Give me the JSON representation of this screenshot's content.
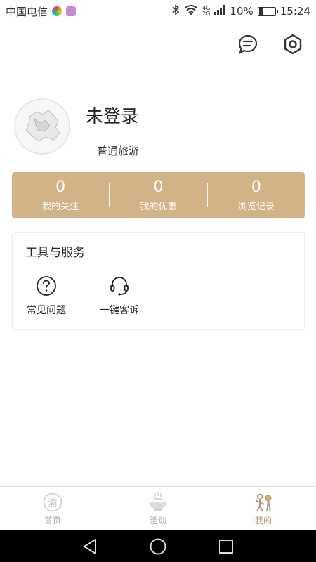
{
  "status_bar": {
    "carrier": "中国电信",
    "network_top": "4G",
    "network_bottom": "2G",
    "battery": "10%",
    "time": "15:24"
  },
  "top_actions": {
    "message_icon": "message-icon",
    "settings_icon": "settings-icon"
  },
  "profile": {
    "login_status": "未登录",
    "user_level": "普通旅游"
  },
  "stats": [
    {
      "value": "0",
      "label": "我的关注"
    },
    {
      "value": "0",
      "label": "我的优惠"
    },
    {
      "value": "0",
      "label": "浏览记录"
    }
  ],
  "tools": {
    "title": "工具与服务",
    "items": [
      {
        "label": "常见问题",
        "icon": "question-icon"
      },
      {
        "label": "一键客诉",
        "icon": "headset-icon"
      }
    ]
  },
  "bottom_nav": [
    {
      "label": "首页",
      "icon": "home-yu-icon",
      "active": false
    },
    {
      "label": "活动",
      "icon": "activity-hotpot-icon",
      "active": false
    },
    {
      "label": "我的",
      "icon": "mine-icon",
      "active": true
    }
  ],
  "colors": {
    "accent": "#d2b287",
    "active_nav": "#b49b7b",
    "inactive_nav": "#aaaaaa"
  }
}
